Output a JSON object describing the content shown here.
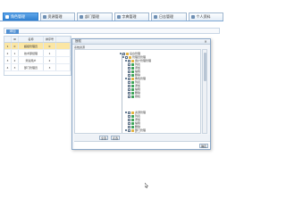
{
  "nav": {
    "tabs": [
      {
        "label": "角色管理",
        "active": true
      },
      {
        "label": "资源管理",
        "active": false
      },
      {
        "label": "部门管理",
        "active": false
      },
      {
        "label": "字典管理",
        "active": false
      },
      {
        "label": "日志管理",
        "active": false
      },
      {
        "label": "个人资料",
        "active": false
      }
    ]
  },
  "page": {
    "head_button": "添加"
  },
  "grid": {
    "columns": [
      "",
      "ID",
      "名称",
      "排序号"
    ],
    "rows": [
      {
        "num": "1",
        "id": "0",
        "name": "超级管理员",
        "sort": "0"
      },
      {
        "num": "2",
        "id": "1",
        "name": "技术部经理",
        "sort": "1"
      },
      {
        "num": "3",
        "id": "2",
        "name": "测试用户",
        "sort": "2"
      },
      {
        "num": "4",
        "id": "3",
        "name": "部门管理员",
        "sort": "3"
      }
    ]
  },
  "dialog": {
    "title": "授权",
    "close_glyph": "✕",
    "subtitle": "系统资源",
    "tree": [
      {
        "label": "后台管理",
        "kind": "folder",
        "depth": 0
      },
      {
        "label": "管理员管理",
        "kind": "folder",
        "depth": 1
      },
      {
        "label": "用户管理管理",
        "kind": "folder",
        "depth": 2
      },
      {
        "label": "列表",
        "kind": "leaf",
        "depth": 3
      },
      {
        "label": "添加",
        "kind": "leaf",
        "depth": 3
      },
      {
        "label": "编辑",
        "kind": "leaf",
        "depth": 3
      },
      {
        "label": "删除",
        "kind": "leaf",
        "depth": 3
      },
      {
        "label": "角色管理",
        "kind": "folder",
        "depth": 2
      },
      {
        "label": "列表",
        "kind": "leaf",
        "depth": 3
      },
      {
        "label": "添加",
        "kind": "leaf",
        "depth": 3
      },
      {
        "label": "编辑",
        "kind": "leaf",
        "depth": 3
      },
      {
        "label": "删除",
        "kind": "leaf",
        "depth": 3
      },
      {
        "label": "授权",
        "kind": "leaf",
        "depth": 3
      },
      {
        "label": "资源管理",
        "kind": "folder",
        "depth": 2
      },
      {
        "label": "列表",
        "kind": "leaf",
        "depth": 3
      },
      {
        "label": "添加",
        "kind": "leaf",
        "depth": 3
      },
      {
        "label": "编辑",
        "kind": "leaf",
        "depth": 3
      },
      {
        "label": "删除",
        "kind": "leaf",
        "depth": 3
      },
      {
        "label": "部门管理",
        "kind": "folder",
        "depth": 2
      },
      {
        "label": "列表",
        "kind": "leaf",
        "depth": 3
      },
      {
        "label": "添加",
        "kind": "leaf",
        "depth": 3
      },
      {
        "label": "编辑",
        "kind": "leaf",
        "depth": 3
      },
      {
        "label": "删除",
        "kind": "leaf",
        "depth": 3
      }
    ],
    "btn_select_all": "全选",
    "btn_invert": "反选",
    "btn_submit": "确定"
  },
  "colors": {
    "active_tab": "#2e7fd0",
    "selected_row": "#fbe6a4",
    "folder": "#e3b341",
    "leaf": "#3fa45a"
  }
}
